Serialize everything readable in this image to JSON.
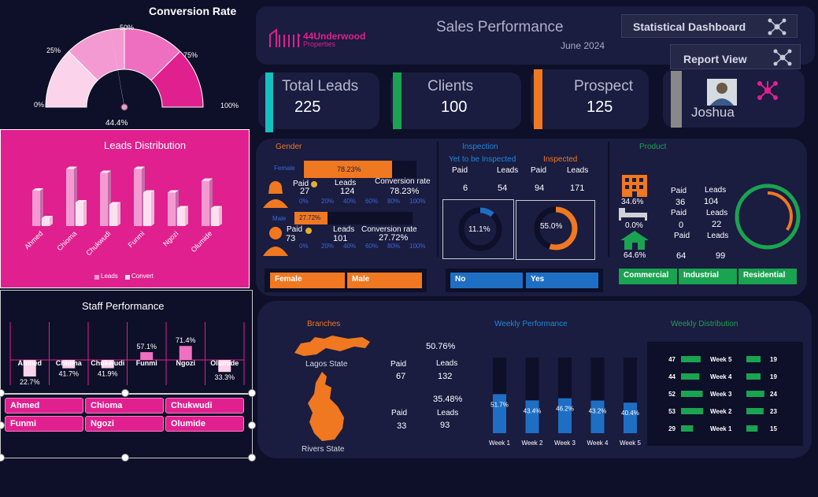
{
  "conversion": {
    "title": "Conversion Rate",
    "value": "44.4%",
    "value_num": 44.4,
    "ticks": {
      "t0": "0%",
      "t25": "25%",
      "t50": "50%",
      "t75": "75%",
      "t100": "100%"
    }
  },
  "leads_dist": {
    "title": "Leads Distribution",
    "legend_leads": "Leads",
    "legend_convert": "Convert"
  },
  "staff_perf": {
    "title": "Staff Performance"
  },
  "header": {
    "logo": "44Underwood",
    "logo_sub": "Properties",
    "title": "Sales Performance",
    "date": "June 2024",
    "stat_btn": "Statistical Dashboard",
    "report_btn": "Report View"
  },
  "kpi": {
    "leads_label": "Total Leads",
    "leads_value": "225",
    "clients_label": "Clients",
    "clients_value": "100",
    "prospect_label": "Prospect",
    "prospect_value": "125",
    "user": "Joshua"
  },
  "gender": {
    "title": "Gender",
    "female_label": "Female",
    "female_pct": "78.23%",
    "female_paid": "27",
    "female_leads": "124",
    "female_conv": "78.23%",
    "male_label": "Male",
    "male_pct": "27.72%",
    "male_paid": "73",
    "male_leads": "101",
    "male_conv": "27.72%",
    "paid": "Paid",
    "leads": "Leads",
    "conv": "Conversion rate",
    "axis": [
      "0%",
      "20%",
      "40%",
      "60%",
      "80%",
      "100%"
    ],
    "btn_female": "Female",
    "btn_male": "Male"
  },
  "inspection": {
    "title": "Inspection",
    "yet_label": "Yet to be Inspected",
    "insp_label": "Inspected",
    "paid": "Paid",
    "leads": "Leads",
    "yet_paid": "6",
    "yet_leads": "54",
    "insp_paid": "94",
    "insp_leads": "171",
    "yet_pct": "11.1%",
    "insp_pct": "55.0%",
    "btn_no": "No",
    "btn_yes": "Yes"
  },
  "product": {
    "title": "Product",
    "paid": "Paid",
    "leads": "Leads",
    "com_pct": "34.6%",
    "com_paid": "36",
    "com_leads": "104",
    "ind_pct": "0.0%",
    "ind_paid": "0",
    "ind_leads": "22",
    "res_pct": "64.6%",
    "res_paid": "64",
    "res_leads": "99",
    "btn_com": "Commercial",
    "btn_ind": "Industrial",
    "btn_res": "Residential"
  },
  "branches": {
    "title": "Branches",
    "lagos": "Lagos State",
    "rivers": "Rivers State",
    "lagos_pct": "50.76%",
    "lagos_paid": "67",
    "lagos_leads": "132",
    "rivers_pct": "35.48%",
    "rivers_paid": "33",
    "rivers_leads": "93",
    "paid": "Paid",
    "leads": "Leads"
  },
  "weekly_perf_title": "Weekly Performance",
  "weekly_dist_title": "Weekly Distribution",
  "staff_buttons": [
    "Ahmed",
    "Chioma",
    "Chukwudi",
    "Funmi",
    "Ngozi",
    "Olumide"
  ],
  "chart_data": [
    {
      "type": "bar",
      "id": "leads_distribution",
      "categories": [
        "Ahmed",
        "Chioma",
        "Chukwudi",
        "Funmi",
        "Ngozi",
        "Olumide"
      ],
      "series": [
        {
          "name": "Leads",
          "values": [
            18,
            29,
            27,
            29,
            17,
            23
          ]
        },
        {
          "name": "Convert",
          "values": [
            4,
            12,
            11,
            17,
            9,
            9
          ]
        }
      ]
    },
    {
      "type": "bar",
      "id": "staff_performance",
      "categories": [
        "Ahmed",
        "Chioma",
        "Chukwudi",
        "Funmi",
        "Ngozi",
        "Olumide"
      ],
      "values": [
        22.7,
        41.7,
        41.9,
        57.1,
        71.4,
        33.3
      ],
      "labels": [
        "22.7%",
        "41.7%",
        "41.9%",
        "57.1%",
        "71.4%",
        "33.3%"
      ]
    },
    {
      "type": "bar",
      "id": "weekly_performance",
      "categories": [
        "Week 1",
        "Week 2",
        "Week 3",
        "Week 4",
        "Week 5"
      ],
      "values": [
        51.7,
        43.4,
        46.2,
        43.2,
        40.4
      ],
      "labels": [
        "51.7%",
        "43.4%",
        "46.2%",
        "43.2%",
        "40.4%"
      ],
      "ylim": [
        0,
        100
      ]
    },
    {
      "type": "bar",
      "id": "weekly_distribution",
      "categories": [
        "Week 5",
        "Week 4",
        "Week 3",
        "Week 2",
        "Week 1"
      ],
      "series": [
        {
          "values": [
            47,
            44,
            52,
            53,
            29
          ]
        },
        {
          "values": [
            19,
            19,
            24,
            23,
            15
          ]
        }
      ]
    }
  ],
  "colors": {
    "bg": "#0e0f28",
    "panel": "#1a1c40",
    "pink": "#e0208e",
    "orange": "#f07820",
    "blue": "#1e6fc4",
    "green": "#1aa350"
  }
}
